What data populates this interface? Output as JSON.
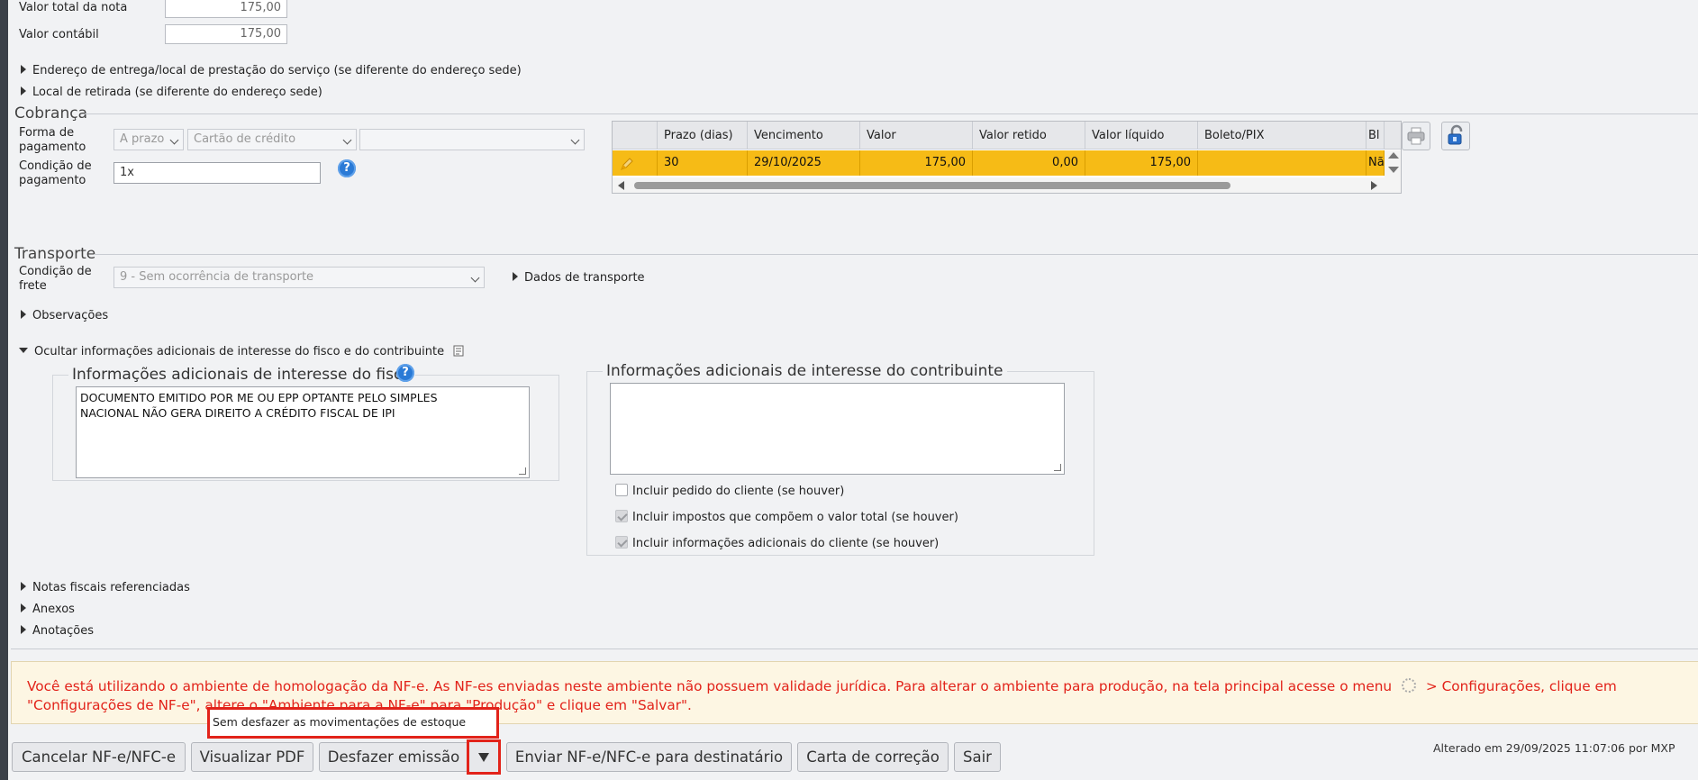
{
  "totals": {
    "valor_total_label": "Valor total da nota",
    "valor_total": "175,00",
    "valor_contabil_label": "Valor contábil",
    "valor_contabil": "175,00"
  },
  "collapsibles": {
    "endereco_entrega": "Endereço de entrega/local de prestação do serviço (se diferente do endereço sede)",
    "local_retirada": "Local de retirada (se diferente do endereço sede)"
  },
  "cobranca": {
    "title": "Cobrança",
    "forma_label": "Forma de pagamento",
    "forma_select": "A prazo",
    "meio_select": "Cartão de crédito",
    "extra_select": "",
    "condicao_label": "Condição de pagamento",
    "condicao_value": "1x",
    "help": "?",
    "grid": {
      "headers": [
        "",
        "Prazo (dias)",
        "Vencimento",
        "Valor",
        "Valor retido",
        "Valor líquido",
        "Boleto/PIX",
        "Bl"
      ],
      "rows": [
        {
          "prazo": "30",
          "vencimento": "29/10/2025",
          "valor": "175,00",
          "retido": "0,00",
          "liquido": "175,00",
          "boleto": "",
          "bl": "Nã"
        }
      ]
    },
    "print_icon": "printer-icon",
    "lock_icon": "unlock-icon"
  },
  "transporte": {
    "title": "Transporte",
    "frete_label": "Condição de frete",
    "frete_select": "9 - Sem ocorrência de transporte",
    "dados_link": "Dados de transporte"
  },
  "observacoes": "Observações",
  "ocultar_info": "Ocultar informações adicionais de interesse do fisco e do contribuinte",
  "fisco": {
    "legend": "Informações adicionais de interesse do fisco",
    "text": "DOCUMENTO EMITIDO POR ME OU EPP OPTANTE PELO SIMPLES\nNACIONAL NÃO GERA DIREITO A CRÉDITO FISCAL DE IPI"
  },
  "contribuinte": {
    "legend": "Informações adicionais de interesse do contribuinte",
    "text": "",
    "checkboxes": [
      {
        "label": "Incluir pedido do cliente (se houver)",
        "checked": false
      },
      {
        "label": "Incluir impostos que compõem o valor total (se houver)",
        "checked": true
      },
      {
        "label": "Incluir informações adicionais do cliente (se houver)",
        "checked": true
      }
    ]
  },
  "sections": {
    "notas_referenciadas": "Notas fiscais referenciadas",
    "anexos": "Anexos",
    "anotacoes": "Anotações"
  },
  "warning": {
    "part1": "Você está utilizando o ambiente de homologação da NF-e. As NF-es enviadas neste ambiente não possuem validade jurídica. Para alterar o ambiente para produção, na tela principal acesse o menu",
    "part2": "> Configurações, clique em \"Configurações de NF-e\", altere o \"Ambiente para a NF-e\" para \"Produção\" e clique em \"Salvar\"."
  },
  "tooltip": "Sem desfazer as movimentações de estoque",
  "buttons": {
    "cancelar": "Cancelar NF-e/NFC-e",
    "visualizar": "Visualizar PDF",
    "desfazer": "Desfazer emissão",
    "enviar": "Enviar NF-e/NFC-e para destinatário",
    "carta": "Carta de correção",
    "sair": "Sair"
  },
  "footer": "Alterado em 29/09/2025 11:07:06 por MXP",
  "colors": {
    "accent_red": "#e2231a",
    "row_highlight": "#f6bb16",
    "help_blue": "#2a7ad6"
  }
}
